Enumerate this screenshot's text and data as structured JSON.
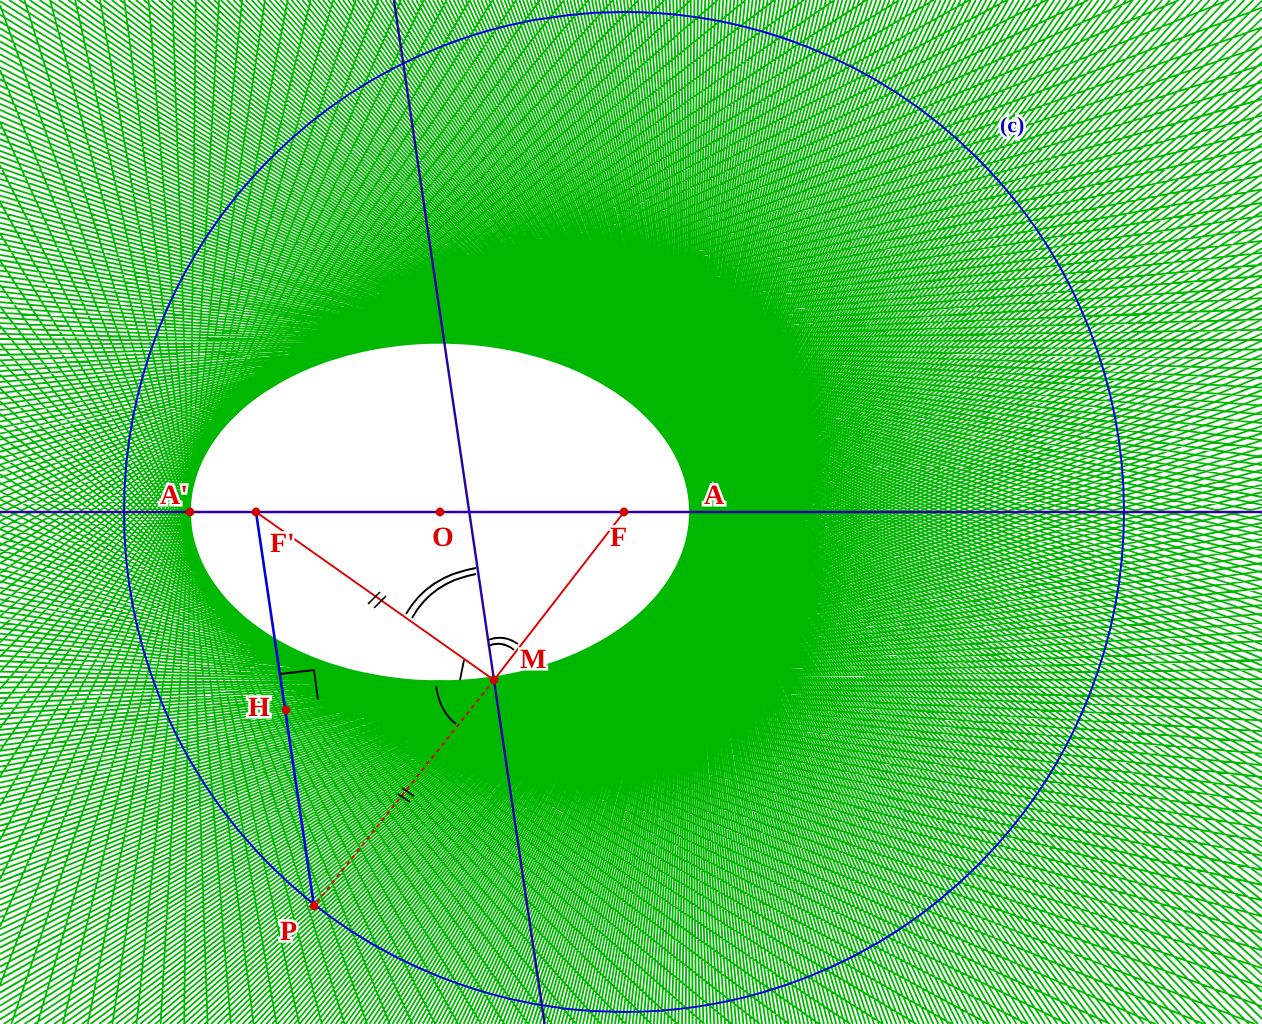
{
  "figure": {
    "circle_label": "(c)",
    "points": [
      {
        "label": "A'"
      },
      {
        "label": "F'"
      },
      {
        "label": "O"
      },
      {
        "label": "F"
      },
      {
        "label": "A"
      },
      {
        "label": "M"
      },
      {
        "label": "H"
      },
      {
        "label": "P"
      }
    ]
  }
}
